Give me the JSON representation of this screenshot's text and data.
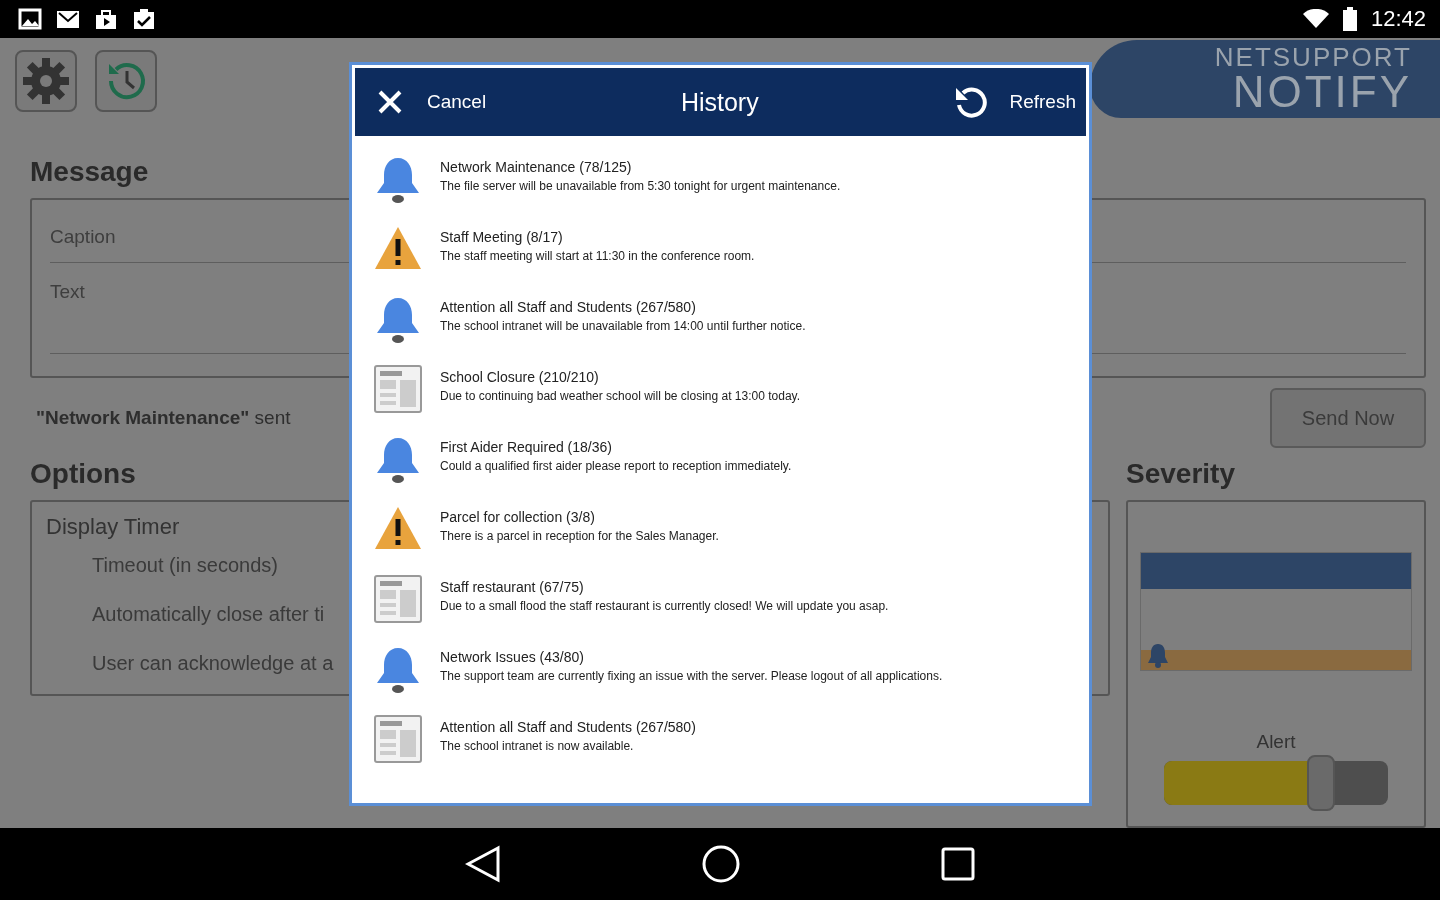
{
  "status_bar": {
    "time": "12:42"
  },
  "toolbar": {
    "logo_top": "NETSUPPORT",
    "logo_bottom": "NOTIFY"
  },
  "message": {
    "heading": "Message",
    "caption_placeholder": "Caption",
    "text_placeholder": "Text",
    "sent_note": "**\"Network Maintenance\"** sent",
    "send_button": "Send Now"
  },
  "options": {
    "heading": "Options",
    "group": "Display Timer",
    "items": [
      "Timeout (in seconds)",
      "Automatically close after ti",
      "User can acknowledge at a"
    ]
  },
  "severity": {
    "heading": "Severity",
    "label": "Alert",
    "level": 0.7
  },
  "dialog": {
    "title": "History",
    "cancel": "Cancel",
    "refresh": "Refresh",
    "items": [
      {
        "kind": "bell",
        "title": "Network Maintenance (78/125)",
        "text": "The file server will be unavailable from 5:30 tonight for urgent maintenance."
      },
      {
        "kind": "warning",
        "title": "Staff Meeting (8/17)",
        "text": "The staff meeting will start at 11:30 in the conference room."
      },
      {
        "kind": "bell",
        "title": "Attention all Staff and Students (267/580)",
        "text": "The school intranet will be unavailable from 14:00 until further notice."
      },
      {
        "kind": "news",
        "title": "School Closure (210/210)",
        "text": "Due to continuing bad weather school will be closing at 13:00 today."
      },
      {
        "kind": "bell",
        "title": "First Aider Required (18/36)",
        "text": "Could a qualified first aider please report to reception immediately."
      },
      {
        "kind": "warning",
        "title": "Parcel for collection (3/8)",
        "text": "There is a parcel in reception for the Sales Manager."
      },
      {
        "kind": "news",
        "title": "Staff restaurant (67/75)",
        "text": "Due to a small flood the staff restaurant is currently closed! We will update you asap."
      },
      {
        "kind": "bell",
        "title": "Network Issues (43/80)",
        "text": "The support team are currently fixing an issue with the server. Please logout of all applications."
      },
      {
        "kind": "news",
        "title": "Attention all Staff and Students (267/580)",
        "text": "The school intranet is now available."
      }
    ]
  }
}
